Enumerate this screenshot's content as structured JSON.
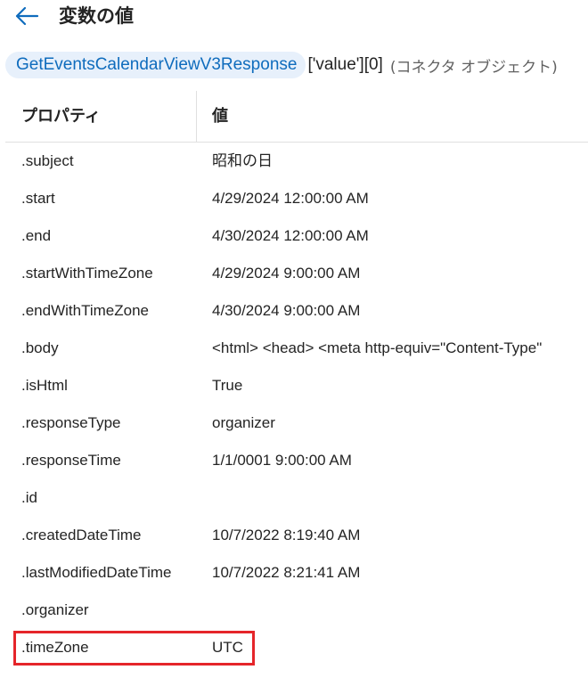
{
  "header": {
    "title": "変数の値",
    "back_icon": "arrow-left-icon"
  },
  "path": {
    "token": "GetEventsCalendarViewV3Response",
    "suffix": "['value'][0]",
    "note": "(コネクタ オブジェクト)"
  },
  "table": {
    "columns": {
      "property": "プロパティ",
      "value": "値"
    },
    "rows": [
      {
        "property": ".subject",
        "value": "昭和の日"
      },
      {
        "property": ".start",
        "value": "4/29/2024 12:00:00 AM"
      },
      {
        "property": ".end",
        "value": "4/30/2024 12:00:00 AM"
      },
      {
        "property": ".startWithTimeZone",
        "value": "4/29/2024 9:00:00 AM"
      },
      {
        "property": ".endWithTimeZone",
        "value": "4/30/2024 9:00:00 AM"
      },
      {
        "property": ".body",
        "value": "<html>  <head>  <meta http-equiv=\"Content-Type\""
      },
      {
        "property": ".isHtml",
        "value": "True"
      },
      {
        "property": ".responseType",
        "value": "organizer"
      },
      {
        "property": ".responseTime",
        "value": "1/1/0001 9:00:00 AM"
      },
      {
        "property": ".id",
        "value": ""
      },
      {
        "property": ".createdDateTime",
        "value": "10/7/2022 8:19:40 AM"
      },
      {
        "property": ".lastModifiedDateTime",
        "value": "10/7/2022 8:21:41 AM"
      },
      {
        "property": ".organizer",
        "value": ""
      },
      {
        "property": ".timeZone",
        "value": "UTC"
      }
    ]
  },
  "colors": {
    "accent": "#0f6cbd",
    "chip_background": "#e7f0fb",
    "highlight_border": "#e5252a"
  }
}
